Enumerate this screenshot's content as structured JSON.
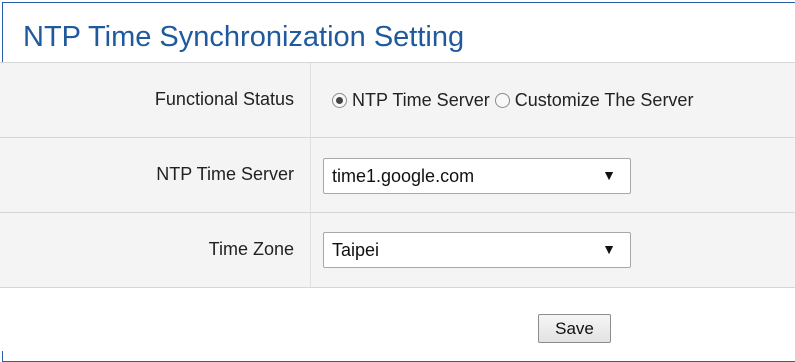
{
  "page": {
    "title": "NTP Time Synchronization Setting"
  },
  "functional_status": {
    "label": "Functional Status",
    "options": [
      {
        "label": "NTP Time Server",
        "selected": true
      },
      {
        "label": "Customize The Server",
        "selected": false
      }
    ]
  },
  "ntp_time_server": {
    "label": "NTP Time Server",
    "value": "time1.google.com",
    "arrow_icon": "dropdown-arrow-icon"
  },
  "time_zone": {
    "label": "Time Zone",
    "value": "Taipei",
    "arrow_icon": "dropdown-arrow-icon"
  },
  "actions": {
    "save_label": "Save"
  },
  "colors": {
    "title": "#1f5a9e",
    "border": "#2b5ea8",
    "row_background": "#f4f4f4"
  }
}
